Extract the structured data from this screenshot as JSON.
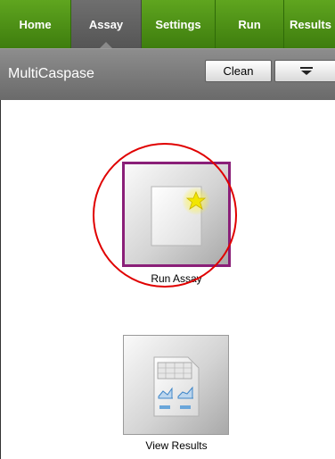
{
  "tabs": [
    {
      "label": "Home",
      "active": false
    },
    {
      "label": "Assay",
      "active": true
    },
    {
      "label": "Settings",
      "active": false
    },
    {
      "label": "Run",
      "active": false
    },
    {
      "label": "Results",
      "active": false
    }
  ],
  "header": {
    "title": "MultiCaspase",
    "clean_label": "Clean",
    "menu_icon": "menu-dropdown-icon"
  },
  "actions": {
    "run_assay": {
      "label": "Run Assay",
      "icon": "new-document-star-icon"
    },
    "view_results": {
      "label": "View Results",
      "icon": "spreadsheet-chart-icon"
    }
  },
  "colors": {
    "tab_green": "#4e921a",
    "active_tab": "#636363",
    "selection_border": "#8a1f78",
    "highlight_ring": "#e00000"
  }
}
